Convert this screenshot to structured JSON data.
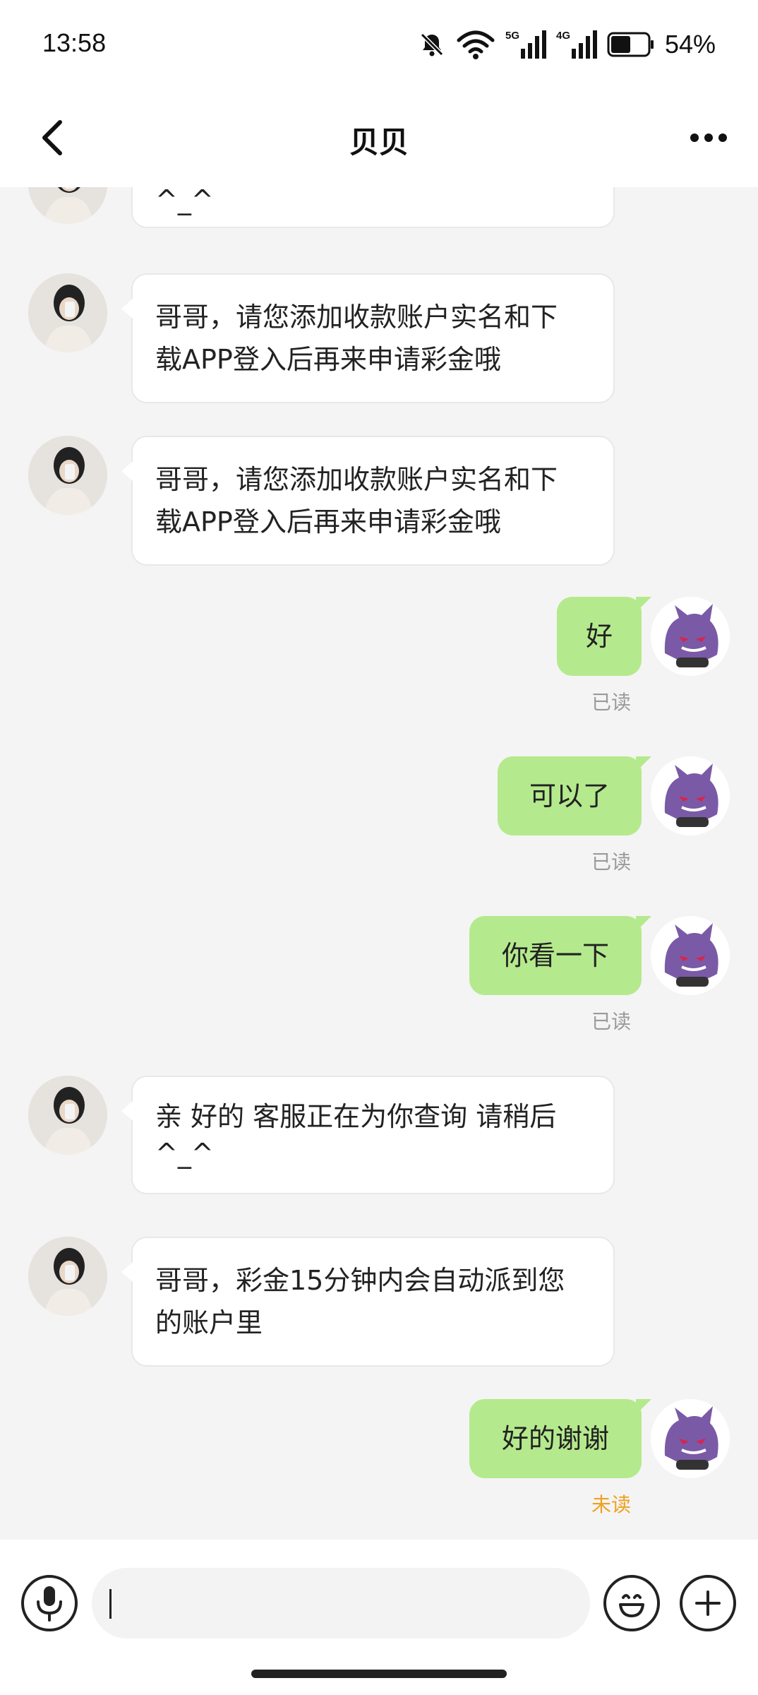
{
  "status_bar": {
    "time": "13:58",
    "battery_pct": "54%",
    "net_5g": "5G",
    "net_4g": "4G",
    "battery_level": 0.54
  },
  "header": {
    "title": "贝贝"
  },
  "messages": {
    "m0": {
      "text": "^_^"
    },
    "m1": {
      "line1": "哥哥，请您添加收款账户实名和下",
      "line2": "载APP登入后再来申请彩金哦"
    },
    "m2": {
      "line1": "哥哥，请您添加收款账户实名和下",
      "line2": "载APP登入后再来申请彩金哦"
    },
    "m3": {
      "text": "好",
      "status": "已读"
    },
    "m4": {
      "text": "可以了",
      "status": "已读"
    },
    "m5": {
      "text": "你看一下",
      "status": "已读"
    },
    "m6": {
      "line1": "亲 好的 客服正在为你查询 请稍后",
      "line2": "^_^"
    },
    "m7": {
      "line1": "哥哥，彩金15分钟内会自动派到您",
      "line2": "的账户里"
    },
    "m8": {
      "text": "好的谢谢",
      "status": "未读"
    }
  },
  "input": {
    "value": "",
    "placeholder": ""
  },
  "colors": {
    "outgoing_bubble": "#b5e98d",
    "incoming_bubble": "#ffffff",
    "unread_status": "#f0a020",
    "read_status": "#9a9a9a"
  },
  "icons": {
    "back": "chevron-left-icon",
    "more": "more-dots-icon",
    "voice": "microphone-icon",
    "emoji": "smiley-icon",
    "plus": "plus-icon",
    "mute": "bell-muted-icon",
    "wifi": "wifi-icon",
    "signal": "signal-bars-icon",
    "battery": "battery-icon"
  }
}
